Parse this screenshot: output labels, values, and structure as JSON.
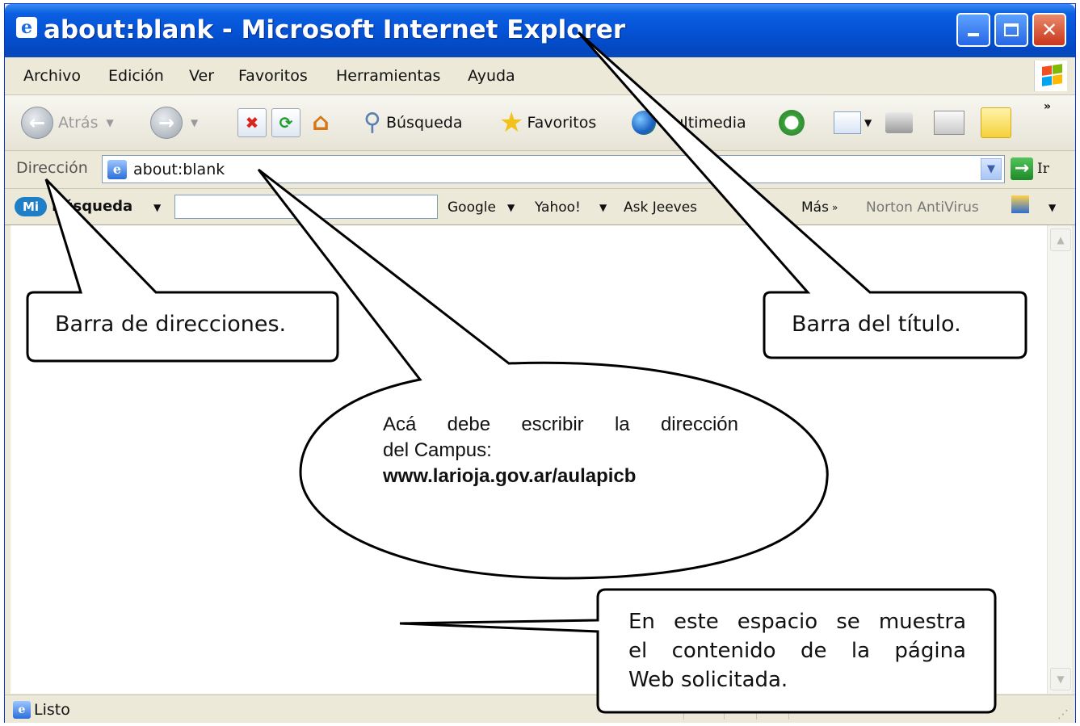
{
  "window": {
    "title": "about:blank - Microsoft Internet Explorer"
  },
  "menu": [
    "Archivo",
    "Edición",
    "Ver",
    "Favoritos",
    "Herramientas",
    "Ayuda"
  ],
  "toolbar": {
    "back_label": "Atrás",
    "search_label": "Búsqueda",
    "favorites_label": "Favoritos",
    "media_label": "Multimedia"
  },
  "address": {
    "label": "Dirección",
    "value": "about:blank",
    "go_label": "Ir"
  },
  "searchbar": {
    "logo": "Mi",
    "label": "Búsqueda",
    "google": "Google",
    "yahoo": "Yahoo!",
    "askjeeves": "Ask Jeeves",
    "more": "Más",
    "norton": "Norton AntiVirus"
  },
  "status": {
    "text": "Listo"
  },
  "callouts": {
    "address_bar": "Barra de direcciones.",
    "title_bar": "Barra del título.",
    "write_address_line1": "Acá debe escribir la dirección",
    "write_address_line2": "del Campus:",
    "url": "www.larioja.gov.ar/aulapicb",
    "content_line1": "En este espacio se muestra",
    "content_line2": "el contenido de la página",
    "content_line3": "Web solicitada."
  }
}
